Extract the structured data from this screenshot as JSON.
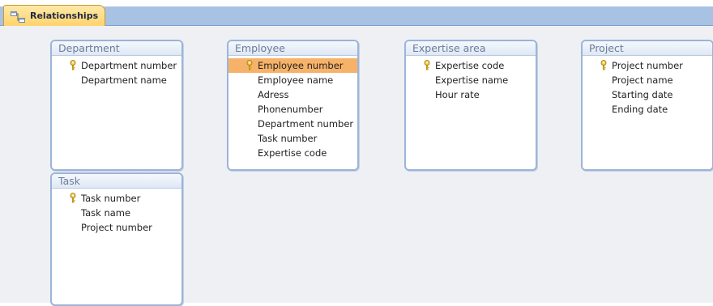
{
  "tab": {
    "label": "Relationships",
    "icon": "relationships-icon"
  },
  "tables": {
    "department": {
      "title": "Department",
      "fields": [
        "Department number",
        "Department name"
      ],
      "primary_key": "Department number"
    },
    "employee": {
      "title": "Employee",
      "fields": [
        "Employee number",
        "Employee name",
        "Adress",
        "Phonenumber",
        "Department number",
        "Task number",
        "Expertise code"
      ],
      "primary_key": "Employee number",
      "selected_field": "Employee number"
    },
    "expertise": {
      "title": "Expertise area",
      "fields": [
        "Expertise code",
        "Expertise name",
        "Hour rate"
      ],
      "primary_key": "Expertise code"
    },
    "project": {
      "title": "Project",
      "fields": [
        "Project number",
        "Project name",
        "Starting date",
        "Ending date"
      ],
      "primary_key": "Project number"
    },
    "task": {
      "title": "Task",
      "fields": [
        "Task number",
        "Task name",
        "Project number"
      ],
      "primary_key": "Task number"
    }
  },
  "colors": {
    "tab_strip": "#a8c2e4",
    "active_tab": "#ffd36b",
    "table_border": "#9cb4d8",
    "selected_row": "#f7b26a",
    "key_icon": "#e2b523"
  }
}
